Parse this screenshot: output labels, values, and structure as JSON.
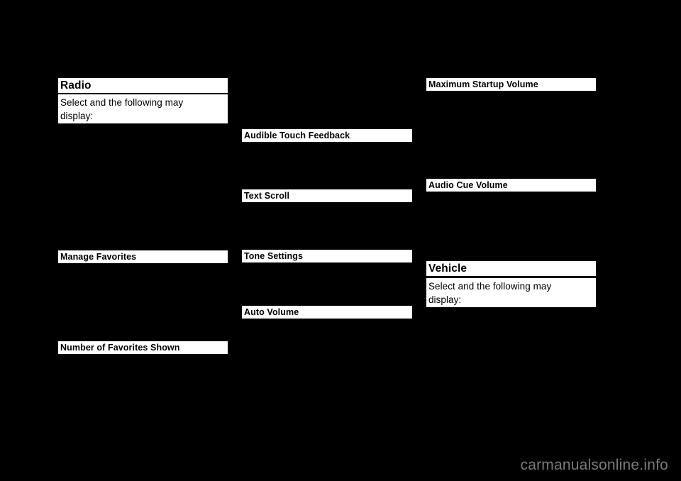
{
  "page": {
    "background_color": "#000000",
    "highlight_background_color": "#ffffff",
    "highlight_text_color": "#000000"
  },
  "columns": {
    "left": {
      "blocks": [
        {
          "id": "radio_heading",
          "text": "Radio",
          "style": "heading-large"
        },
        {
          "id": "radio_body",
          "text": "Select and the following may\ndisplay:",
          "style": "body"
        },
        {
          "id": "manage_favorites",
          "text": "Manage Favorites",
          "style": "heading-small"
        },
        {
          "id": "number_of_favorites_shown",
          "text": "Number of Favorites Shown",
          "style": "heading-small"
        }
      ]
    },
    "middle": {
      "blocks": [
        {
          "id": "audible_touch_feedback",
          "text": "Audible Touch Feedback",
          "style": "heading-small"
        },
        {
          "id": "text_scroll",
          "text": "Text Scroll",
          "style": "heading-small"
        },
        {
          "id": "tone_settings",
          "text": "Tone Settings",
          "style": "heading-small"
        },
        {
          "id": "auto_volume",
          "text": "Auto Volume",
          "style": "heading-small"
        }
      ]
    },
    "right": {
      "blocks": [
        {
          "id": "maximum_startup_volume",
          "text": "Maximum Startup Volume",
          "style": "heading-small"
        },
        {
          "id": "audio_cue_volume",
          "text": "Audio Cue Volume",
          "style": "heading-small"
        },
        {
          "id": "vehicle_heading",
          "text": "Vehicle",
          "style": "heading-large"
        },
        {
          "id": "vehicle_body",
          "text": "Select and the following may\ndisplay:",
          "style": "body"
        }
      ]
    }
  },
  "footer": {
    "watermark": "carmanualsonline.info",
    "watermark_color": "#7a7a7a"
  }
}
